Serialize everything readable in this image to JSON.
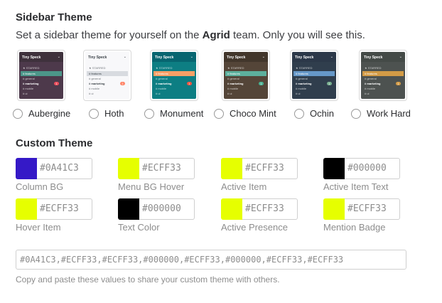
{
  "sidebar_theme": {
    "title": "Sidebar Theme",
    "description_pre": "Set a sidebar theme for yourself on the ",
    "team": "Agrid",
    "description_post": " team. Only you will see this.",
    "thumb_text": {
      "team": "Tiny Speck",
      "starred": "★ STARRED",
      "features": "# features",
      "general": "# general",
      "marketing": "# marketing",
      "mobile": "# mobile",
      "ui": "# ui",
      "badge": "1"
    },
    "themes": [
      {
        "label": "Aubergine",
        "bg": "#4d394b",
        "header": "#3e313c",
        "active": "#4c9689",
        "text": "#ffffff",
        "badge": "#eb4d5c"
      },
      {
        "label": "Hoth",
        "bg": "#f8f8fa",
        "header": "#f8f8fa",
        "active": "#d8dbe0",
        "text": "#383f45",
        "badge": "#ff8669"
      },
      {
        "label": "Monument",
        "bg": "#0d7e83",
        "header": "#076570",
        "active": "#f79f66",
        "text": "#ffffff",
        "badge": "#f15340"
      },
      {
        "label": "Choco Mint",
        "bg": "#544538",
        "header": "#42362b",
        "active": "#5db09d",
        "text": "#ffffff",
        "badge": "#4ab293"
      },
      {
        "label": "Ochin",
        "bg": "#303e4d",
        "header": "#2c3849",
        "active": "#6698c8",
        "text": "#ffffff",
        "badge": "#78af8f"
      },
      {
        "label": "Work Hard",
        "bg": "#4d5250",
        "header": "#444a47",
        "active": "#d39b46",
        "text": "#ffffff",
        "badge": "#d39b46"
      }
    ]
  },
  "custom_theme": {
    "title": "Custom Theme",
    "swatches": [
      {
        "label": "Column BG",
        "value": "#0A41C3",
        "color": "#3519c7"
      },
      {
        "label": "Menu BG Hover",
        "value": "#ECFF33",
        "color": "#e6ff00"
      },
      {
        "label": "Active Item",
        "value": "#ECFF33",
        "color": "#e6ff00"
      },
      {
        "label": "Active Item Text",
        "value": "#000000",
        "color": "#000000"
      },
      {
        "label": "Hover Item",
        "value": "#ECFF33",
        "color": "#e6ff00"
      },
      {
        "label": "Text Color",
        "value": "#000000",
        "color": "#000000"
      },
      {
        "label": "Active Presence",
        "value": "#ECFF33",
        "color": "#e6ff00"
      },
      {
        "label": "Mention Badge",
        "value": "#ECFF33",
        "color": "#e6ff00"
      }
    ],
    "values": "#0A41C3,#ECFF33,#ECFF33,#000000,#ECFF33,#000000,#ECFF33,#ECFF33",
    "help": "Copy and paste these values to share your custom theme with others."
  }
}
